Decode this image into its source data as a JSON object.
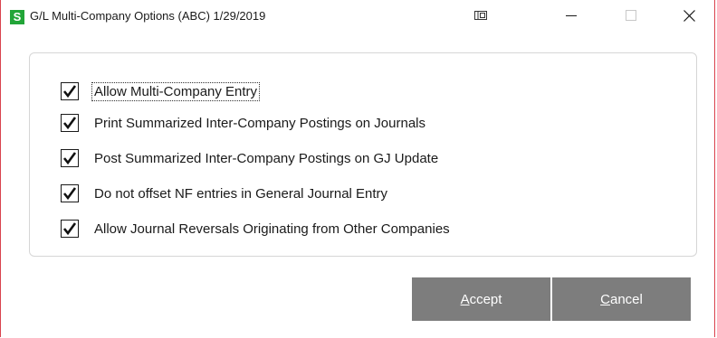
{
  "window": {
    "title": "G/L Multi-Company Options (ABC) 1/29/2019",
    "logo_letter": "S",
    "accent": "#22a538",
    "border_color": "#d9434e"
  },
  "titlebar_buttons": {
    "restore_panel": "panel-icon",
    "minimize": "minimize-icon",
    "maximize": "maximize-icon",
    "close": "close-icon"
  },
  "options": [
    {
      "label": "Allow Multi-Company Entry",
      "checked": true,
      "focused": true
    },
    {
      "label": "Print Summarized Inter-Company Postings on Journals",
      "checked": true,
      "focused": false
    },
    {
      "label": "Post Summarized Inter-Company Postings on GJ Update",
      "checked": true,
      "focused": false
    },
    {
      "label": "Do not offset NF entries in General Journal Entry",
      "checked": true,
      "focused": false
    },
    {
      "label": "Allow Journal Reversals Originating from Other Companies",
      "checked": true,
      "focused": false
    }
  ],
  "buttons": {
    "accept": {
      "mnemonic": "A",
      "rest": "ccept"
    },
    "cancel": {
      "mnemonic": "C",
      "rest": "ancel"
    },
    "color": "#7d7d7d"
  }
}
